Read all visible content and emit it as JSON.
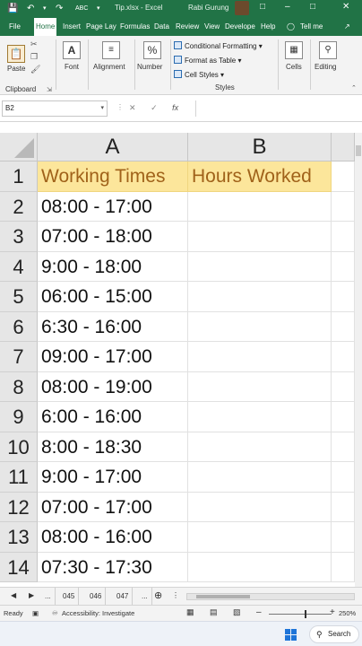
{
  "titlebar": {
    "filename": "Tip.xlsx",
    "app": "Excel",
    "user": "Rabi Gurung"
  },
  "tabs": [
    "File",
    "Home",
    "Insert",
    "Page Lay",
    "Formulas",
    "Data",
    "Review",
    "View",
    "Develope",
    "Help",
    "Tell me"
  ],
  "active_tab": "Home",
  "ribbon": {
    "paste": "Paste",
    "clipboard": "Clipboard",
    "font": "Font",
    "alignment": "Alignment",
    "number": "Number",
    "conditional_formatting": "Conditional Formatting",
    "format_as_table": "Format as Table",
    "cell_styles": "Cell Styles",
    "styles": "Styles",
    "cells": "Cells",
    "editing": "Editing"
  },
  "formula_bar": {
    "name_box": "B2",
    "fx": "fx"
  },
  "columns": [
    "A",
    "B"
  ],
  "rows": [
    {
      "num": "1",
      "a": "Working Times",
      "b": "Hours Worked"
    },
    {
      "num": "2",
      "a": "08:00 - 17:00",
      "b": ""
    },
    {
      "num": "3",
      "a": "07:00 - 18:00",
      "b": ""
    },
    {
      "num": "4",
      "a": "9:00 - 18:00",
      "b": ""
    },
    {
      "num": "5",
      "a": "06:00 - 15:00",
      "b": ""
    },
    {
      "num": "6",
      "a": "6:30 - 16:00",
      "b": ""
    },
    {
      "num": "7",
      "a": "09:00 - 17:00",
      "b": ""
    },
    {
      "num": "8",
      "a": "08:00 - 19:00",
      "b": ""
    },
    {
      "num": "9",
      "a": "6:00 - 16:00",
      "b": ""
    },
    {
      "num": "10",
      "a": "8:00 - 18:30",
      "b": ""
    },
    {
      "num": "11",
      "a": "9:00 - 17:00",
      "b": ""
    },
    {
      "num": "12",
      "a": "07:00 - 17:00",
      "b": ""
    },
    {
      "num": "13",
      "a": "08:00 - 16:00",
      "b": ""
    },
    {
      "num": "14",
      "a": "07:30 - 17:30",
      "b": ""
    }
  ],
  "sheet_tabs": [
    "...",
    "045",
    "046",
    "047",
    "..."
  ],
  "status": {
    "ready": "Ready",
    "accessibility": "Accessibility: Investigate",
    "zoom": "250%"
  },
  "taskbar": {
    "search": "Search"
  },
  "colors": {
    "excel_green": "#217346",
    "header_fill": "#fce69b",
    "header_text": "#a0621a"
  }
}
